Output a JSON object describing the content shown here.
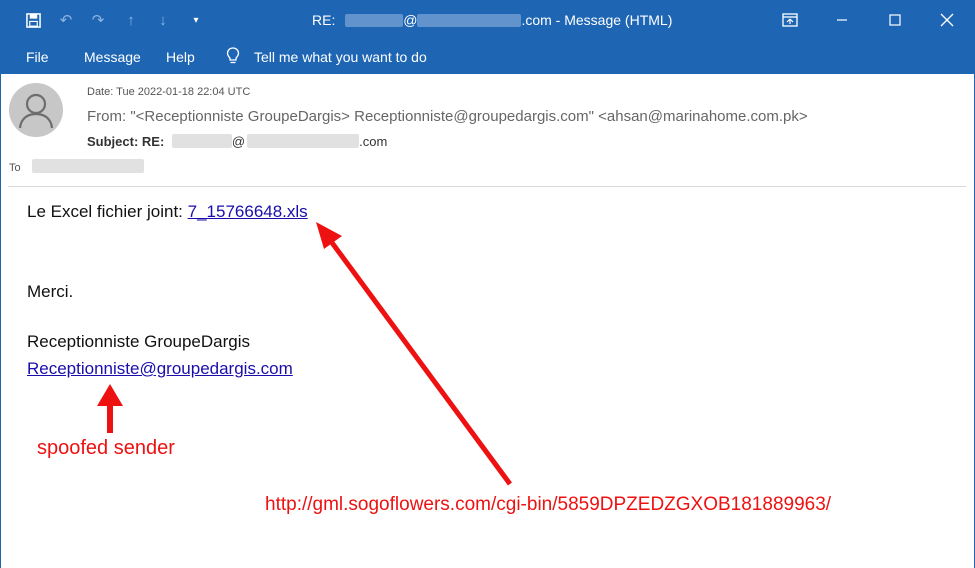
{
  "window": {
    "title_prefix": "RE:",
    "title_at": "@",
    "title_suffix": ".com  -  Message (HTML)"
  },
  "menu": {
    "file": "File",
    "message": "Message",
    "help": "Help",
    "tell_me": "Tell me what you want to do"
  },
  "header": {
    "date": "Date: Tue 2022-01-18 22:04 UTC",
    "from": "From: \"<Receptionniste GroupeDargis> Receptionniste@groupedargis.com\" <ahsan@marinahome.com.pk>",
    "subject_label": "Subject: RE:",
    "subject_at": "@",
    "subject_suffix": ".com",
    "to_label": "To"
  },
  "body": {
    "attachment_prefix": "Le Excel fichier joint: ",
    "attachment_link": "7_15766648.xls",
    "thanks": "Merci.",
    "signature_name": "Receptionniste GroupeDargis",
    "signature_email": "Receptionniste@groupedargis.com"
  },
  "annotations": {
    "spoofed": "spoofed sender",
    "url": "http://gml.sogoflowers.com/cgi-bin/5859DPZEDZGXOB181889963/",
    "color": "#ee1111"
  },
  "colors": {
    "accent": "#1e66b4",
    "link": "#1a0dab"
  }
}
